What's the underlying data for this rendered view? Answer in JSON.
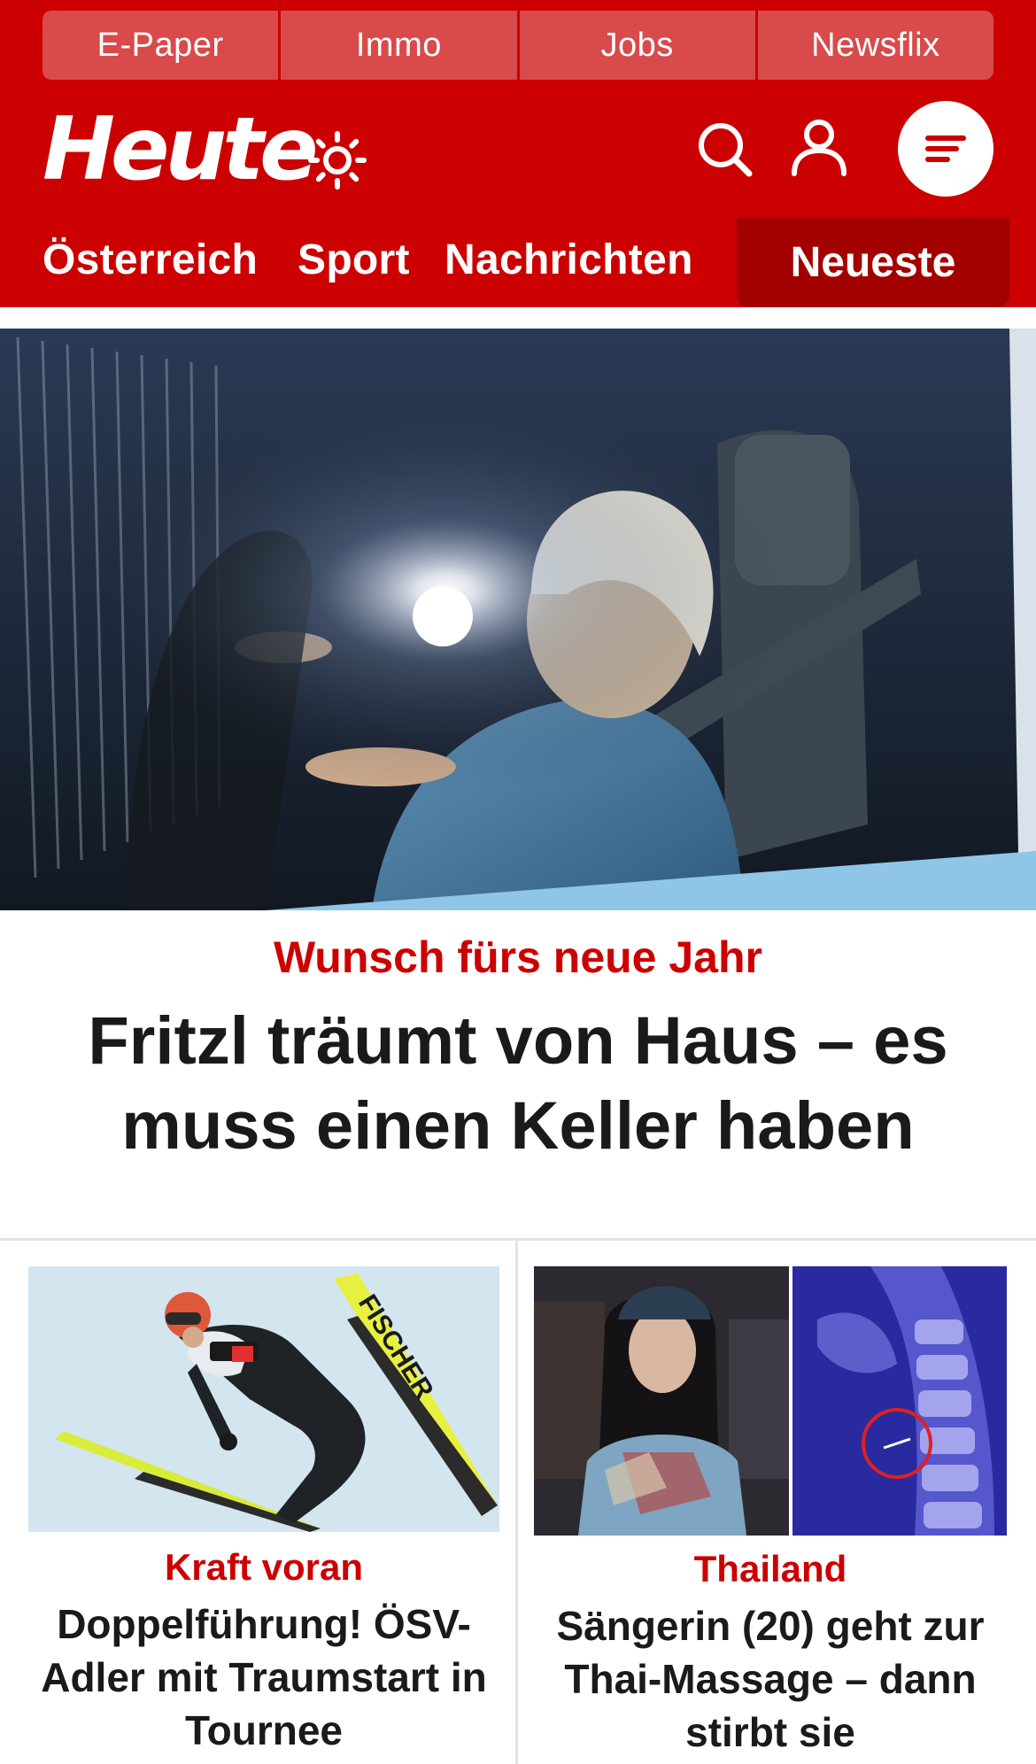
{
  "top_links": [
    "E-Paper",
    "Immo",
    "Jobs",
    "Newsflix"
  ],
  "brand": {
    "logo": "Heute",
    "icons": {
      "theme": "sun-icon",
      "search": "search-icon",
      "account": "user-icon",
      "menu": "hamburger-menu-icon"
    }
  },
  "nav": {
    "items": [
      "Österreich",
      "Sport",
      "Nachrichten"
    ],
    "highlighted": "Neueste"
  },
  "hero": {
    "kicker": "Wunsch fürs neue Jahr",
    "title": "Fritzl träumt von Haus – es muss einen Keller haben"
  },
  "teasers": [
    {
      "kicker": "Kraft voran",
      "title": "Doppelführung! ÖSV-Adler mit Traumstart in Tournee",
      "image_text": "FISCHER"
    },
    {
      "kicker": "Thailand",
      "title": "Sängerin (20) geht zur Thai-Massage – dann stirbt sie"
    }
  ],
  "colors": {
    "brand_red": "#cc0000",
    "tab_red": "#d94a4a",
    "active_tab_red": "#a30000",
    "text": "#1a1a1a"
  }
}
